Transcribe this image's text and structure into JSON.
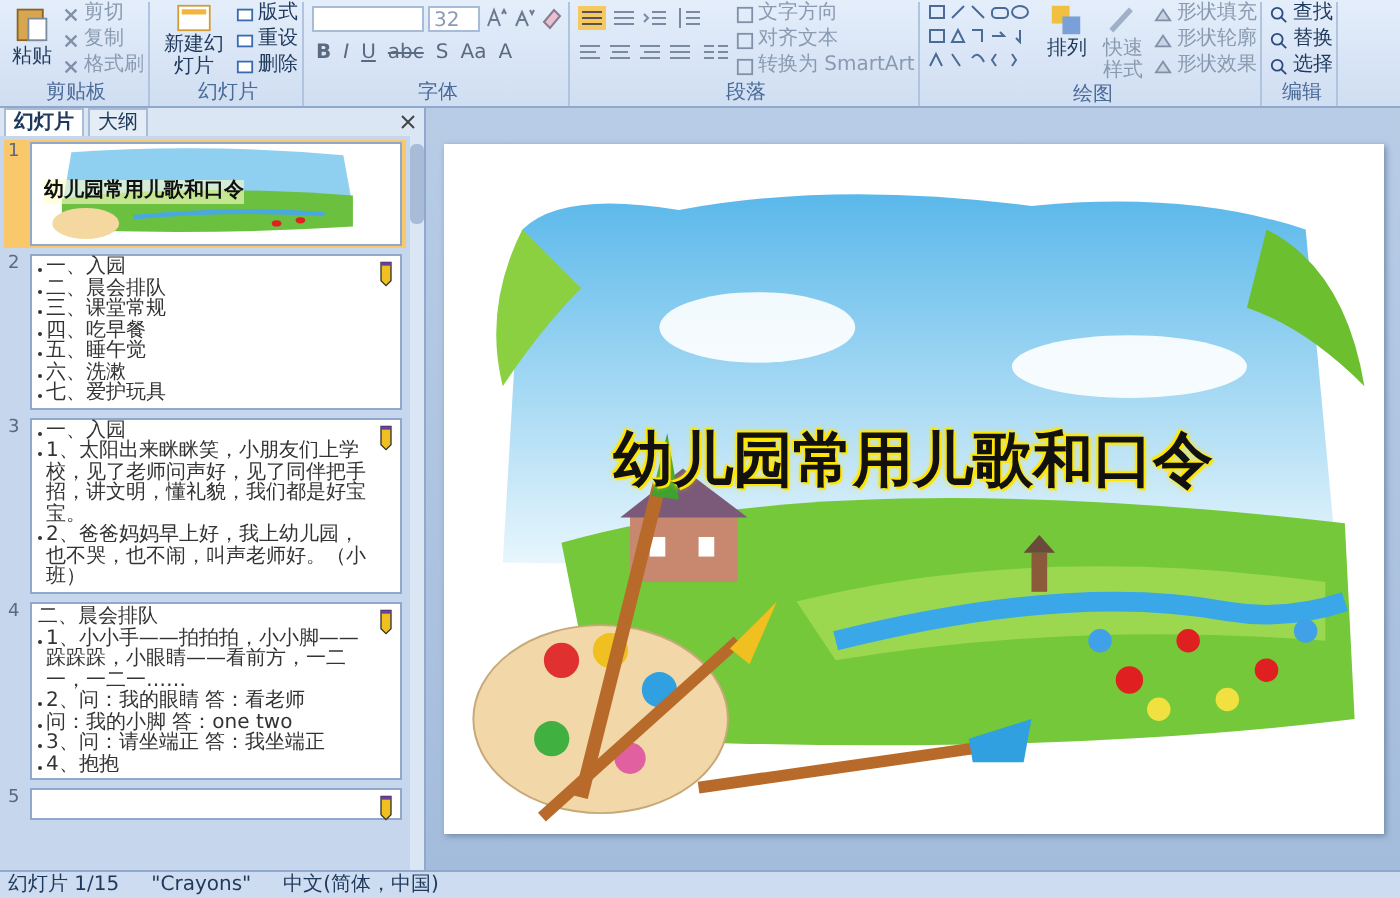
{
  "ribbon": {
    "groups": [
      {
        "kind": "clipboard",
        "label": "剪贴板",
        "big": "粘贴",
        "items": [
          "剪切",
          "复制",
          "格式刷"
        ]
      },
      {
        "kind": "slides",
        "label": "幻灯片",
        "big": "新建幻灯片",
        "items": [
          "版式",
          "重设",
          "删除"
        ]
      },
      {
        "kind": "font",
        "label": "字体",
        "font_size": "32",
        "buttons": [
          "B",
          "I",
          "U",
          "abc",
          "S",
          "Aa",
          "A"
        ]
      },
      {
        "kind": "paragraph",
        "label": "段落",
        "items": [
          "文字方向",
          "对齐文本",
          "转换为 SmartArt"
        ]
      },
      {
        "kind": "drawing",
        "label": "绘图",
        "big": "排列",
        "quick": "快速样式",
        "items": [
          "形状填充",
          "形状轮廓",
          "形状效果"
        ]
      },
      {
        "kind": "editing",
        "label": "编辑",
        "items": [
          "查找",
          "替换",
          "选择"
        ]
      }
    ]
  },
  "panel": {
    "tabs": [
      {
        "label": "幻灯片",
        "selected": true
      },
      {
        "label": "大纲",
        "selected": false
      }
    ],
    "slides": [
      {
        "number": "1",
        "kind": "title",
        "selected": true,
        "title": "幼儿园常用儿歌和口令"
      },
      {
        "number": "2",
        "kind": "list",
        "selected": false,
        "items": [
          "一、入园",
          "二、晨会排队",
          "三、课堂常规",
          "四、吃早餐",
          "五、睡午觉",
          "六、洗漱",
          "七、爱护玩具"
        ]
      },
      {
        "number": "3",
        "kind": "text",
        "selected": false,
        "lines": [
          "一、入园",
          "1、太阳出来眯眯笑，小朋友们上学校，见了老师问声好，见了同伴把手招，讲文明，懂礼貌，我们都是好宝宝。",
          "2、爸爸妈妈早上好，我上幼儿园，也不哭，也不闹，叫声老师好。（小班）"
        ]
      },
      {
        "number": "4",
        "kind": "heading",
        "selected": false,
        "heading": "二、晨会排队",
        "lines": [
          "1、小小手——拍拍拍，小小脚——跺跺跺，小眼睛——看前方，一二一，一二一……",
          "2、问：我的眼睛 答：看老师",
          "问：我的小脚 答：one two",
          "3、问：请坐端正 答：我坐端正",
          "4、抱抱"
        ]
      },
      {
        "number": "5",
        "kind": "partial",
        "selected": false
      }
    ]
  },
  "slide": {
    "title": "幼儿园常用儿歌和口令"
  },
  "status_bar": [
    "幻灯片 1/15",
    "\"Crayons\"",
    "中文(简体，中国)"
  ]
}
